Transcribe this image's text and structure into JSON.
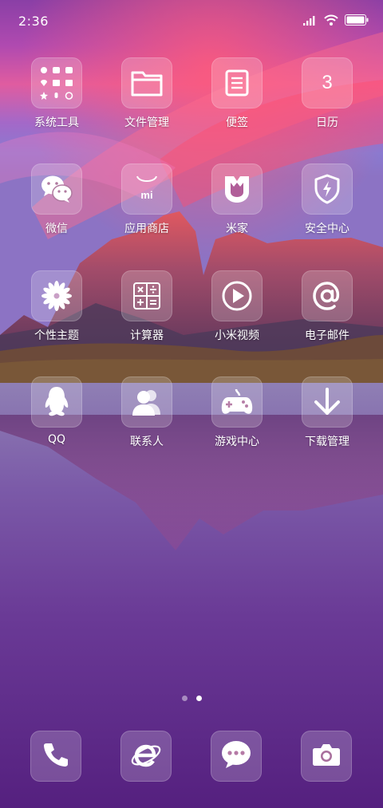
{
  "status_bar": {
    "time": "2:36"
  },
  "apps": [
    {
      "label": "系统工具",
      "icon": "tools-folder-icon"
    },
    {
      "label": "文件管理",
      "icon": "folder-icon"
    },
    {
      "label": "便签",
      "icon": "notes-icon"
    },
    {
      "label": "日历",
      "icon": "calendar-icon",
      "badge_text": "3"
    },
    {
      "label": "微信",
      "icon": "wechat-icon"
    },
    {
      "label": "应用商店",
      "icon": "app-store-icon"
    },
    {
      "label": "米家",
      "icon": "mijia-icon"
    },
    {
      "label": "安全中心",
      "icon": "security-shield-icon"
    },
    {
      "label": "个性主题",
      "icon": "theme-flower-icon"
    },
    {
      "label": "计算器",
      "icon": "calculator-icon"
    },
    {
      "label": "小米视频",
      "icon": "video-play-icon"
    },
    {
      "label": "电子邮件",
      "icon": "email-at-icon"
    },
    {
      "label": "QQ",
      "icon": "qq-penguin-icon"
    },
    {
      "label": "联系人",
      "icon": "contacts-icon"
    },
    {
      "label": "游戏中心",
      "icon": "gamepad-icon"
    },
    {
      "label": "下载管理",
      "icon": "download-arrow-icon"
    }
  ],
  "page_indicator": {
    "pages": 2,
    "active_page": 2
  },
  "dock": [
    {
      "icon": "phone-icon"
    },
    {
      "icon": "browser-icon"
    },
    {
      "icon": "messages-icon"
    },
    {
      "icon": "camera-icon"
    }
  ],
  "colors": {
    "tile_bg": "rgba(255,255,255,0.20)",
    "text": "#ffffff"
  }
}
